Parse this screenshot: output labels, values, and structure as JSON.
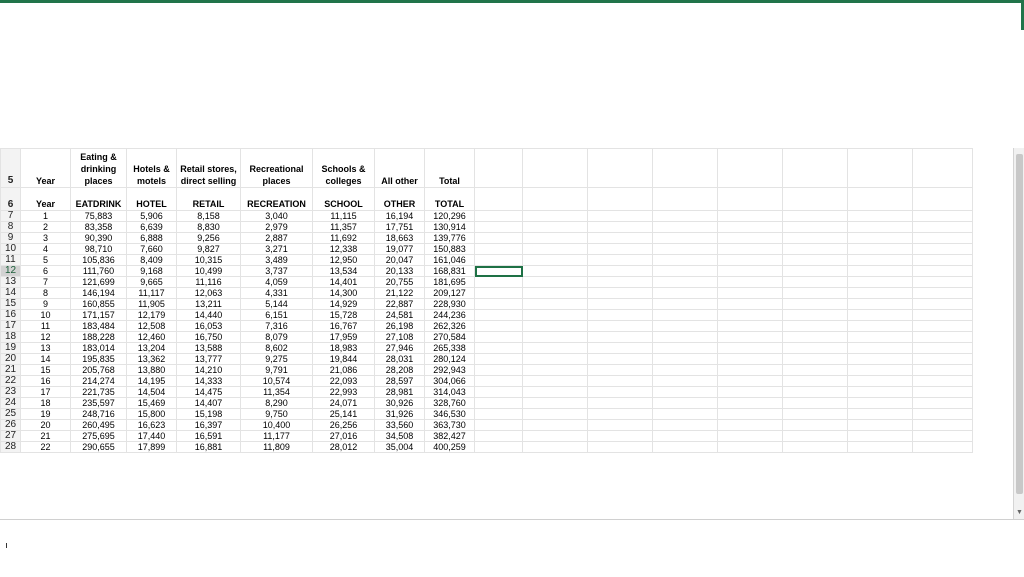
{
  "spreadsheet": {
    "header_labels": [
      "Year",
      "Eating & drinking places",
      "Hotels & motels",
      "Retail stores, direct selling",
      "Recreational places",
      "Schools & colleges",
      "All other",
      "Total"
    ],
    "code_labels": [
      "Year",
      "EATDRINK",
      "HOTEL",
      "RETAIL",
      "RECREATION",
      "SCHOOL",
      "OTHER",
      "TOTAL"
    ],
    "header_row_num": "5",
    "code_row_num": "6",
    "selected_row": "12",
    "rows": [
      {
        "r": "7",
        "v": [
          "1",
          "75,883",
          "5,906",
          "8,158",
          "3,040",
          "11,115",
          "16,194",
          "120,296"
        ]
      },
      {
        "r": "8",
        "v": [
          "2",
          "83,358",
          "6,639",
          "8,830",
          "2,979",
          "11,357",
          "17,751",
          "130,914"
        ]
      },
      {
        "r": "9",
        "v": [
          "3",
          "90,390",
          "6,888",
          "9,256",
          "2,887",
          "11,692",
          "18,663",
          "139,776"
        ]
      },
      {
        "r": "10",
        "v": [
          "4",
          "98,710",
          "7,660",
          "9,827",
          "3,271",
          "12,338",
          "19,077",
          "150,883"
        ]
      },
      {
        "r": "11",
        "v": [
          "5",
          "105,836",
          "8,409",
          "10,315",
          "3,489",
          "12,950",
          "20,047",
          "161,046"
        ]
      },
      {
        "r": "12",
        "v": [
          "6",
          "111,760",
          "9,168",
          "10,499",
          "3,737",
          "13,534",
          "20,133",
          "168,831"
        ]
      },
      {
        "r": "13",
        "v": [
          "7",
          "121,699",
          "9,665",
          "11,116",
          "4,059",
          "14,401",
          "20,755",
          "181,695"
        ]
      },
      {
        "r": "14",
        "v": [
          "8",
          "146,194",
          "11,117",
          "12,063",
          "4,331",
          "14,300",
          "21,122",
          "209,127"
        ]
      },
      {
        "r": "15",
        "v": [
          "9",
          "160,855",
          "11,905",
          "13,211",
          "5,144",
          "14,929",
          "22,887",
          "228,930"
        ]
      },
      {
        "r": "16",
        "v": [
          "10",
          "171,157",
          "12,179",
          "14,440",
          "6,151",
          "15,728",
          "24,581",
          "244,236"
        ]
      },
      {
        "r": "17",
        "v": [
          "11",
          "183,484",
          "12,508",
          "16,053",
          "7,316",
          "16,767",
          "26,198",
          "262,326"
        ]
      },
      {
        "r": "18",
        "v": [
          "12",
          "188,228",
          "12,460",
          "16,750",
          "8,079",
          "17,959",
          "27,108",
          "270,584"
        ]
      },
      {
        "r": "19",
        "v": [
          "13",
          "183,014",
          "13,204",
          "13,588",
          "8,602",
          "18,983",
          "27,946",
          "265,338"
        ]
      },
      {
        "r": "20",
        "v": [
          "14",
          "195,835",
          "13,362",
          "13,777",
          "9,275",
          "19,844",
          "28,031",
          "280,124"
        ]
      },
      {
        "r": "21",
        "v": [
          "15",
          "205,768",
          "13,880",
          "14,210",
          "9,791",
          "21,086",
          "28,208",
          "292,943"
        ]
      },
      {
        "r": "22",
        "v": [
          "16",
          "214,274",
          "14,195",
          "14,333",
          "10,574",
          "22,093",
          "28,597",
          "304,066"
        ]
      },
      {
        "r": "23",
        "v": [
          "17",
          "221,735",
          "14,504",
          "14,475",
          "11,354",
          "22,993",
          "28,981",
          "314,043"
        ]
      },
      {
        "r": "24",
        "v": [
          "18",
          "235,597",
          "15,469",
          "14,407",
          "8,290",
          "24,071",
          "30,926",
          "328,760"
        ]
      },
      {
        "r": "25",
        "v": [
          "19",
          "248,716",
          "15,800",
          "15,198",
          "9,750",
          "25,141",
          "31,926",
          "346,530"
        ]
      },
      {
        "r": "26",
        "v": [
          "20",
          "260,495",
          "16,623",
          "16,397",
          "10,400",
          "26,256",
          "33,560",
          "363,730"
        ]
      },
      {
        "r": "27",
        "v": [
          "21",
          "275,695",
          "17,440",
          "16,591",
          "11,177",
          "27,016",
          "34,508",
          "382,427"
        ]
      },
      {
        "r": "28",
        "v": [
          "22",
          "290,655",
          "17,899",
          "16,881",
          "11,809",
          "28,012",
          "35,004",
          "400,259"
        ]
      }
    ]
  }
}
